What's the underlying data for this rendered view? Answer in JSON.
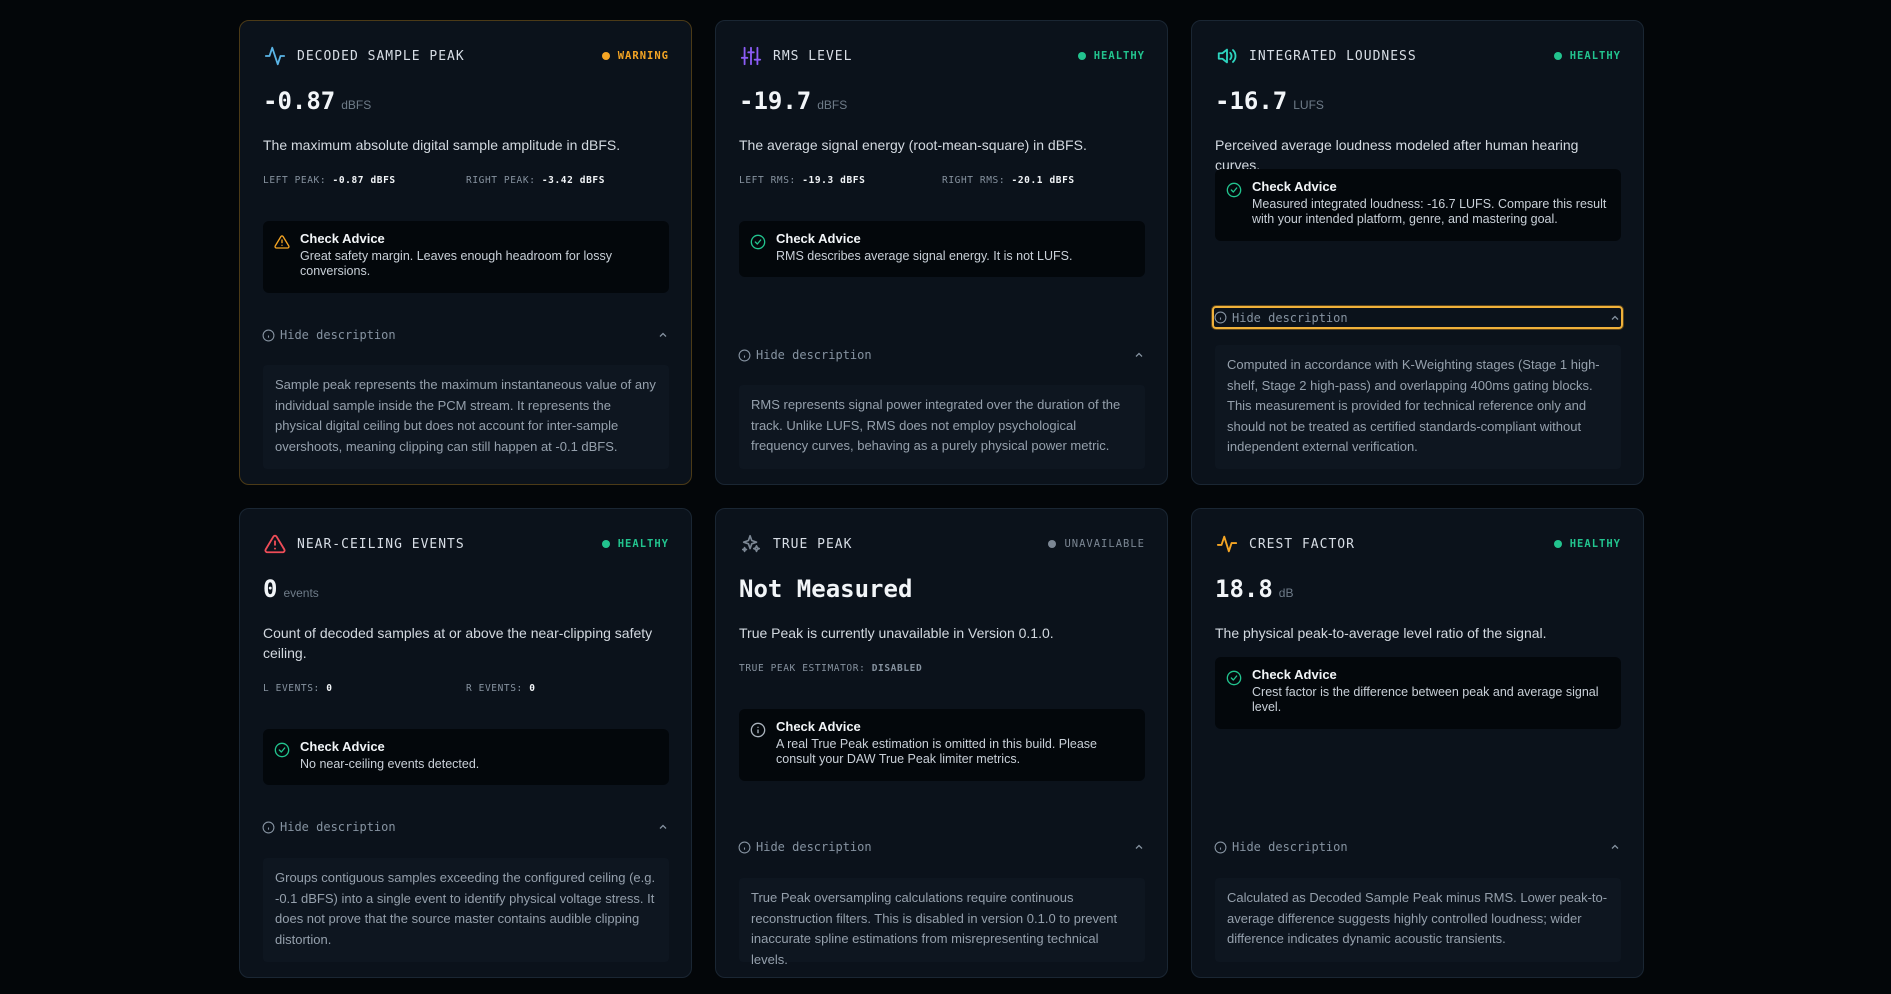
{
  "cards": [
    {
      "title": "DECODED SAMPLE PEAK",
      "status": "WARNING",
      "value": "-0.87",
      "unit": "dBFS",
      "description": "The maximum absolute digital sample amplitude in dBFS.",
      "metrics": [
        {
          "label": "LEFT PEAK:",
          "value": "-0.87 dBFS"
        },
        {
          "label": "RIGHT PEAK:",
          "value": "-3.42 dBFS"
        }
      ],
      "advice_title": "Check Advice",
      "advice_body": "Great safety margin. Leaves enough headroom for lossy conversions.",
      "toggle_label": "Hide description",
      "long_description": "Sample peak represents the maximum instantaneous value of any individual sample inside the PCM stream. It represents the physical digital ceiling but does not account for inter-sample overshoots, meaning clipping can still happen at -0.1 dBFS."
    },
    {
      "title": "RMS LEVEL",
      "status": "HEALTHY",
      "value": "-19.7",
      "unit": "dBFS",
      "description": "The average signal energy (root-mean-square) in dBFS.",
      "metrics": [
        {
          "label": "LEFT RMS:",
          "value": "-19.3 dBFS"
        },
        {
          "label": "RIGHT RMS:",
          "value": "-20.1 dBFS"
        }
      ],
      "advice_title": "Check Advice",
      "advice_body": "RMS describes average signal energy. It is not LUFS.",
      "toggle_label": "Hide description",
      "long_description": "RMS represents signal power integrated over the duration of the track. Unlike LUFS, RMS does not employ psychological frequency curves, behaving as a purely physical power metric."
    },
    {
      "title": "INTEGRATED LOUDNESS",
      "status": "HEALTHY",
      "value": "-16.7",
      "unit": "LUFS",
      "description": "Perceived average loudness modeled after human hearing curves.",
      "advice_title": "Check Advice",
      "advice_body": "Measured integrated loudness: -16.7 LUFS. Compare this result with your intended platform, genre, and mastering goal.",
      "toggle_label": "Hide description",
      "long_description": "Computed in accordance with K-Weighting stages (Stage 1 high-shelf, Stage 2 high-pass) and overlapping 400ms gating blocks. This measurement is provided for technical reference only and should not be treated as certified standards-compliant without independent external verification."
    },
    {
      "title": "NEAR-CEILING EVENTS",
      "status": "HEALTHY",
      "value": "0",
      "unit": "events",
      "description": "Count of decoded samples at or above the near-clipping safety ceiling.",
      "metrics": [
        {
          "label": "L EVENTS:",
          "value": "0"
        },
        {
          "label": "R EVENTS:",
          "value": "0"
        }
      ],
      "advice_title": "Check Advice",
      "advice_body": "No near-ceiling events detected.",
      "toggle_label": "Hide description",
      "long_description": "Groups contiguous samples exceeding the configured ceiling (e.g. -0.1 dBFS) into a single event to identify physical voltage stress. It does not prove that the source master contains audible clipping distortion."
    },
    {
      "title": "TRUE PEAK",
      "status": "UNAVAILABLE",
      "value": "Not Measured",
      "description": "True Peak is currently unavailable in Version 0.1.0.",
      "metrics": [
        {
          "label": "TRUE PEAK ESTIMATOR:",
          "value": "DISABLED"
        }
      ],
      "advice_title": "Check Advice",
      "advice_body": "A real True Peak estimation is omitted in this build. Please consult your DAW True Peak limiter metrics.",
      "toggle_label": "Hide description",
      "long_description": "True Peak oversampling calculations require continuous reconstruction filters. This is disabled in version 0.1.0 to prevent inaccurate spline estimations from misrepresenting technical levels."
    },
    {
      "title": "CREST FACTOR",
      "status": "HEALTHY",
      "value": "18.8",
      "unit": "dB",
      "description": "The physical peak-to-average level ratio of the signal.",
      "advice_title": "Check Advice",
      "advice_body": "Crest factor is the difference between peak and average signal level.",
      "toggle_label": "Hide description",
      "long_description": "Calculated as Decoded Sample Peak minus RMS. Lower peak-to-average difference suggests highly controlled loudness; wider difference indicates dynamic acoustic transients."
    }
  ],
  "colors": {
    "healthy": "#22c38e",
    "warning": "#f5a524",
    "unavailable": "#7c8794",
    "danger": "#ef4d58",
    "accent_purple": "#8b5cf6",
    "accent_blue": "#5ab4e6",
    "accent_teal": "#2dd4bf",
    "focus": "#f0b13a"
  },
  "icons": [
    "activity-icon",
    "sliders-icon",
    "volume-icon",
    "alert-triangle-icon",
    "sparkles-icon",
    "pulse-icon",
    "check-circle-icon",
    "info-circle-icon",
    "chevron-up-icon"
  ]
}
